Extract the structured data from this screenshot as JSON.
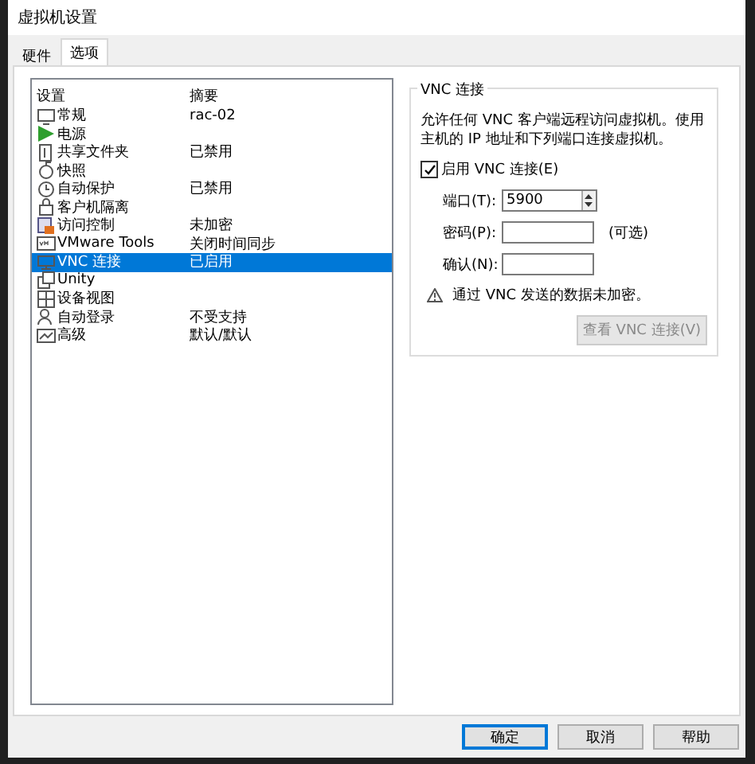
{
  "window": {
    "title": "虚拟机设置"
  },
  "tabs": [
    {
      "label": "硬件",
      "selected": false
    },
    {
      "label": "选项",
      "selected": true
    }
  ],
  "settings_list": {
    "columns": [
      "设置",
      "摘要"
    ],
    "rows": [
      {
        "name": "常规",
        "summary": "rac-02",
        "selected": false
      },
      {
        "name": "电源",
        "selected": false
      },
      {
        "name": "共享文件夹",
        "summary": "已禁用",
        "selected": false
      },
      {
        "name": "快照",
        "selected": false
      },
      {
        "name": "自动保护",
        "summary": "已禁用",
        "selected": false
      },
      {
        "name": "客户机隔离",
        "selected": false
      },
      {
        "name": "访问控制",
        "summary": "未加密",
        "selected": false
      },
      {
        "name": "VMware Tools",
        "summary": "关闭时间同步",
        "selected": false
      },
      {
        "name": "VNC 连接",
        "summary": "已启用",
        "selected": true
      },
      {
        "name": "Unity",
        "selected": false
      },
      {
        "name": "设备视图",
        "selected": false
      },
      {
        "name": "自动登录",
        "summary": "不受支持",
        "selected": false
      },
      {
        "name": "高级",
        "summary": "默认/默认",
        "selected": false
      }
    ]
  },
  "vnc_group": {
    "title": "VNC 连接",
    "description": "允许任何 VNC 客户端远程访问虚拟机。使用主机的 IP 地址和下列端口连接虚拟机。",
    "enable_checkbox": {
      "label": "启用 VNC 连接(E)",
      "checked": true
    },
    "port": {
      "label": "端口(T):",
      "value": "5900"
    },
    "password": {
      "label": "密码(P):",
      "hint": "(可选)"
    },
    "confirm": {
      "label": "确认(N):"
    },
    "warning": "通过 VNC 发送的数据未加密。",
    "view_button": {
      "label": "查看 VNC 连接(V)",
      "disabled": true
    }
  },
  "buttons": [
    {
      "label": "确定",
      "selected": true
    },
    {
      "label": "取消",
      "selected": false
    },
    {
      "label": "帮助",
      "selected": false
    }
  ]
}
